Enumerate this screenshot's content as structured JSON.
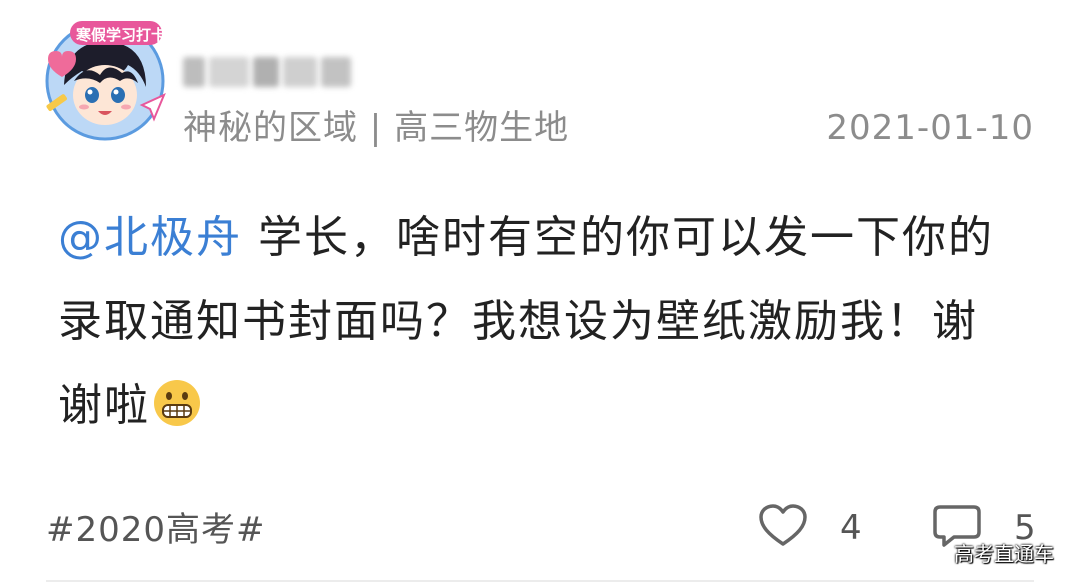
{
  "post": {
    "author": {
      "badge_text": "寒假学习打卡",
      "subtitle": "神秘的区域 | 高三物生地"
    },
    "date": "2021-01-10",
    "content": {
      "mention": "@北极舟",
      "text": " 学长，啥时有空的你可以发一下你的录取通知书封面吗？我想设为壁纸激励我！谢谢啦",
      "emoji_icon": "grimacing-face-emoji"
    },
    "hashtag": "#2020高考#",
    "likes": "4",
    "comments": "5"
  },
  "watermark": "高考直通车",
  "colors": {
    "mention": "#3b7fd4",
    "text": "#222222",
    "secondary": "#8c8c8c",
    "avatar_ring": "#9ec3ef",
    "badge": "#e8579b"
  }
}
